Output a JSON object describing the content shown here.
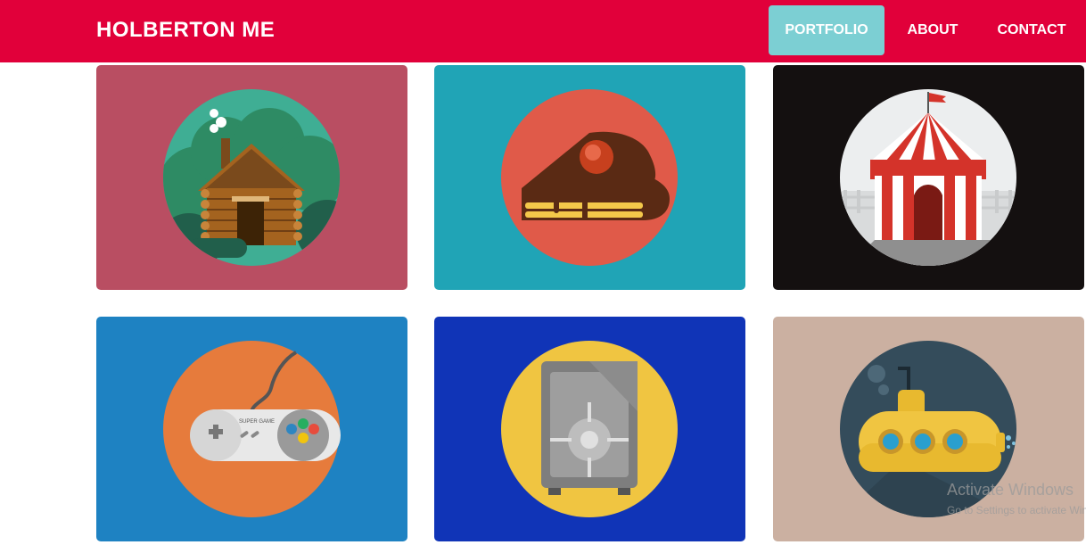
{
  "nav": {
    "brand": "HOLBERTON ME",
    "links": [
      {
        "label": "PORTFOLIO",
        "active": true
      },
      {
        "label": "ABOUT",
        "active": false
      },
      {
        "label": "CONTACT",
        "active": false
      }
    ]
  },
  "portfolio": {
    "items": [
      {
        "icon": "log-cabin-icon",
        "background": "#b94e62",
        "circle": "#3fae94"
      },
      {
        "icon": "cake-slice-icon",
        "background": "#20a4b6",
        "circle": "#e05a49"
      },
      {
        "icon": "circus-tent-icon",
        "background": "#141010",
        "circle": "#eceeef"
      },
      {
        "icon": "game-controller-icon",
        "background": "#1e82c2",
        "circle": "#e67b3c"
      },
      {
        "icon": "safe-icon",
        "background": "#1034b7",
        "circle": "#f0c541"
      },
      {
        "icon": "submarine-icon",
        "background": "#cbb0a1",
        "circle": "#344c5b"
      }
    ]
  },
  "controller_text": "SUPER GAME",
  "watermark": {
    "line1": "Activate Windows",
    "line2": "Go to Settings to activate Windows."
  },
  "colors": {
    "navbar": "#e1003a",
    "active_link": "#7ccfd3"
  }
}
